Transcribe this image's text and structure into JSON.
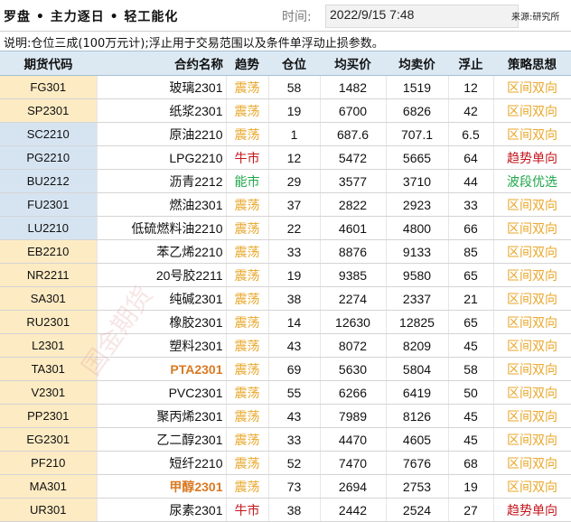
{
  "header": {
    "title": "罗盘 • 主力逐日 • 轻工能化",
    "time_label": "时间:",
    "time_value": "2022/9/15 7:48",
    "source": "来源:研究所"
  },
  "note": "说明:仓位三成(100万元计);浮止用于交易范围以及条件单浮动止损参数。",
  "watermark": "国金期货",
  "colors": {
    "zhendang": "#e8a72a",
    "niushi": "#c4161c",
    "nengshi": "#1ea64a",
    "quyin": "#e8a72a",
    "qushi": "#c4161c",
    "boduan": "#1ea64a",
    "highlight_name": "#d97a23",
    "code_yellow": "#fdebc3",
    "code_blue": "#d6e4f1",
    "header_bg": "#dce9f3"
  },
  "table": {
    "headers": [
      "期货代码",
      "合约名称",
      "趋势",
      "仓位",
      "均买价",
      "均卖价",
      "浮止",
      "策略思想"
    ],
    "rows": [
      {
        "code": "FG301",
        "name": "玻璃2301",
        "trend": "震荡",
        "pos": "58",
        "buy": "1482",
        "sell": "1519",
        "stop": "12",
        "strategy": "区间双向",
        "code_bg": "y",
        "trend_c": "orange",
        "strat_c": "orange"
      },
      {
        "code": "SP2301",
        "name": "纸浆2301",
        "trend": "震荡",
        "pos": "19",
        "buy": "6700",
        "sell": "6826",
        "stop": "42",
        "strategy": "区间双向",
        "code_bg": "y",
        "trend_c": "orange",
        "strat_c": "orange"
      },
      {
        "code": "SC2210",
        "name": "原油2210",
        "trend": "震荡",
        "pos": "1",
        "buy": "687.6",
        "sell": "707.1",
        "stop": "6.5",
        "strategy": "区间双向",
        "code_bg": "b",
        "trend_c": "orange",
        "strat_c": "orange"
      },
      {
        "code": "PG2210",
        "name": "LPG2210",
        "trend": "牛市",
        "pos": "12",
        "buy": "5472",
        "sell": "5665",
        "stop": "64",
        "strategy": "趋势单向",
        "code_bg": "b",
        "trend_c": "red",
        "strat_c": "red"
      },
      {
        "code": "BU2212",
        "name": "沥青2212",
        "trend": "能市",
        "pos": "29",
        "buy": "3577",
        "sell": "3710",
        "stop": "44",
        "strategy": "波段优选",
        "code_bg": "b",
        "trend_c": "green",
        "strat_c": "green"
      },
      {
        "code": "FU2301",
        "name": "燃油2301",
        "trend": "震荡",
        "pos": "37",
        "buy": "2822",
        "sell": "2923",
        "stop": "33",
        "strategy": "区间双向",
        "code_bg": "b",
        "trend_c": "orange",
        "strat_c": "orange"
      },
      {
        "code": "LU2210",
        "name": "低硫燃料油2210",
        "trend": "震荡",
        "pos": "22",
        "buy": "4601",
        "sell": "4800",
        "stop": "66",
        "strategy": "区间双向",
        "code_bg": "b",
        "trend_c": "orange",
        "strat_c": "orange"
      },
      {
        "code": "EB2210",
        "name": "苯乙烯2210",
        "trend": "震荡",
        "pos": "33",
        "buy": "8876",
        "sell": "9133",
        "stop": "85",
        "strategy": "区间双向",
        "code_bg": "y",
        "trend_c": "orange",
        "strat_c": "orange"
      },
      {
        "code": "NR2211",
        "name": "20号胶2211",
        "trend": "震荡",
        "pos": "19",
        "buy": "9385",
        "sell": "9580",
        "stop": "65",
        "strategy": "区间双向",
        "code_bg": "y",
        "trend_c": "orange",
        "strat_c": "orange"
      },
      {
        "code": "SA301",
        "name": "纯碱2301",
        "trend": "震荡",
        "pos": "38",
        "buy": "2274",
        "sell": "2337",
        "stop": "21",
        "strategy": "区间双向",
        "code_bg": "y",
        "trend_c": "orange",
        "strat_c": "orange"
      },
      {
        "code": "RU2301",
        "name": "橡胶2301",
        "trend": "震荡",
        "pos": "14",
        "buy": "12630",
        "sell": "12825",
        "stop": "65",
        "strategy": "区间双向",
        "code_bg": "y",
        "trend_c": "orange",
        "strat_c": "orange"
      },
      {
        "code": "L2301",
        "name": "塑料2301",
        "trend": "震荡",
        "pos": "43",
        "buy": "8072",
        "sell": "8209",
        "stop": "45",
        "strategy": "区间双向",
        "code_bg": "y",
        "trend_c": "orange",
        "strat_c": "orange"
      },
      {
        "code": "TA301",
        "name": "PTA2301",
        "trend": "震荡",
        "pos": "69",
        "buy": "5630",
        "sell": "5804",
        "stop": "58",
        "strategy": "区间双向",
        "code_bg": "y",
        "trend_c": "orange",
        "strat_c": "orange",
        "hl": true
      },
      {
        "code": "V2301",
        "name": "PVC2301",
        "trend": "震荡",
        "pos": "55",
        "buy": "6266",
        "sell": "6419",
        "stop": "50",
        "strategy": "区间双向",
        "code_bg": "y",
        "trend_c": "orange",
        "strat_c": "orange"
      },
      {
        "code": "PP2301",
        "name": "聚丙烯2301",
        "trend": "震荡",
        "pos": "43",
        "buy": "7989",
        "sell": "8126",
        "stop": "45",
        "strategy": "区间双向",
        "code_bg": "y",
        "trend_c": "orange",
        "strat_c": "orange"
      },
      {
        "code": "EG2301",
        "name": "乙二醇2301",
        "trend": "震荡",
        "pos": "33",
        "buy": "4470",
        "sell": "4605",
        "stop": "45",
        "strategy": "区间双向",
        "code_bg": "y",
        "trend_c": "orange",
        "strat_c": "orange"
      },
      {
        "code": "PF210",
        "name": "短纤2210",
        "trend": "震荡",
        "pos": "52",
        "buy": "7470",
        "sell": "7676",
        "stop": "68",
        "strategy": "区间双向",
        "code_bg": "y",
        "trend_c": "orange",
        "strat_c": "orange"
      },
      {
        "code": "MA301",
        "name": "甲醇2301",
        "trend": "震荡",
        "pos": "73",
        "buy": "2694",
        "sell": "2753",
        "stop": "19",
        "strategy": "区间双向",
        "code_bg": "y",
        "trend_c": "orange",
        "strat_c": "orange",
        "hl": true
      },
      {
        "code": "UR301",
        "name": "尿素2301",
        "trend": "牛市",
        "pos": "38",
        "buy": "2442",
        "sell": "2524",
        "stop": "27",
        "strategy": "趋势单向",
        "code_bg": "y",
        "trend_c": "red",
        "strat_c": "red"
      }
    ]
  }
}
